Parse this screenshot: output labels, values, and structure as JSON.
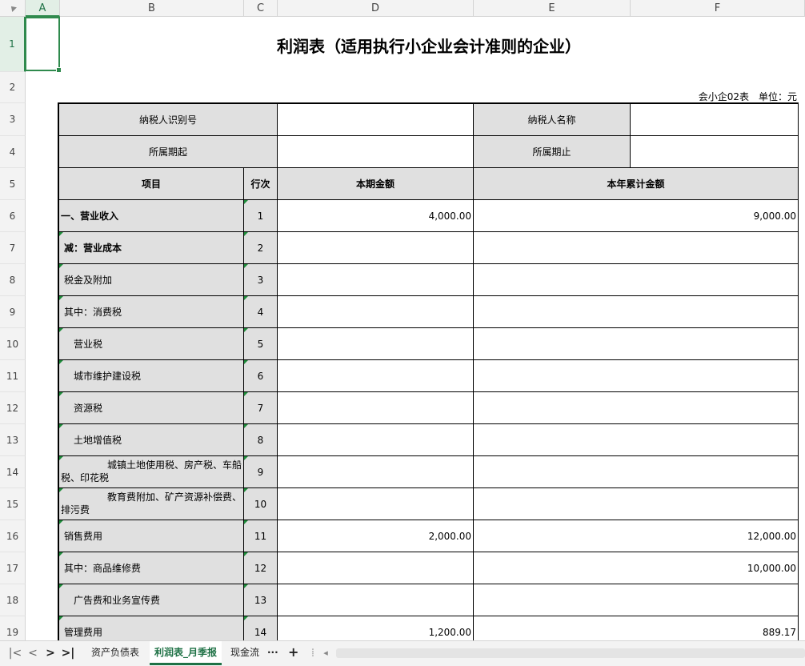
{
  "columns": [
    "A",
    "B",
    "C",
    "D",
    "E",
    "F"
  ],
  "rows": [
    "1",
    "2",
    "3",
    "4",
    "5",
    "6",
    "7",
    "8",
    "9",
    "10",
    "11",
    "12",
    "13",
    "14",
    "15",
    "16",
    "17",
    "18",
    "19"
  ],
  "sheet": {
    "title": "利润表（适用执行小企业会计准则的企业）",
    "unit_note": "会小企02表　单位：元",
    "taxpayer_id_label": "纳税人识别号",
    "taxpayer_id_value": "",
    "taxpayer_name_label": "纳税人名称",
    "taxpayer_name_value": "",
    "period_start_label": "所属期起",
    "period_start_value": "",
    "period_end_label": "所属期止",
    "period_end_value": "",
    "header_item": "项目",
    "header_line": "行次",
    "header_current": "本期金额",
    "header_ytd": "本年累计金额",
    "items": [
      {
        "label": "一、营业收入",
        "line": "1",
        "current": "4,000.00",
        "ytd": "9,000.00",
        "bold": true,
        "indent": 0
      },
      {
        "label": "减：营业成本",
        "line": "2",
        "current": "",
        "ytd": "",
        "bold": true,
        "indent": 1
      },
      {
        "label": "税金及附加",
        "line": "3",
        "current": "",
        "ytd": "",
        "bold": false,
        "indent": 1
      },
      {
        "label": "其中：消费税",
        "line": "4",
        "current": "",
        "ytd": "",
        "bold": false,
        "indent": 2
      },
      {
        "label": "营业税",
        "line": "5",
        "current": "",
        "ytd": "",
        "bold": false,
        "indent": 3
      },
      {
        "label": "城市维护建设税",
        "line": "6",
        "current": "",
        "ytd": "",
        "bold": false,
        "indent": 3
      },
      {
        "label": "资源税",
        "line": "7",
        "current": "",
        "ytd": "",
        "bold": false,
        "indent": 3
      },
      {
        "label": "土地增值税",
        "line": "8",
        "current": "",
        "ytd": "",
        "bold": false,
        "indent": 3
      },
      {
        "label": "城镇土地使用税、房产税、车船税、印花税",
        "line": "9",
        "current": "",
        "ytd": "",
        "bold": false,
        "indent": 4
      },
      {
        "label": "教育费附加、矿产资源补偿费、排污费",
        "line": "10",
        "current": "",
        "ytd": "",
        "bold": false,
        "indent": 4
      },
      {
        "label": "销售费用",
        "line": "11",
        "current": "2,000.00",
        "ytd": "12,000.00",
        "bold": false,
        "indent": 1
      },
      {
        "label": "其中：商品维修费",
        "line": "12",
        "current": "",
        "ytd": "10,000.00",
        "bold": false,
        "indent": 2
      },
      {
        "label": "广告费和业务宣传费",
        "line": "13",
        "current": "",
        "ytd": "",
        "bold": false,
        "indent": 3
      },
      {
        "label": "管理费用",
        "line": "14",
        "current": "1,200.00",
        "ytd": "889.17",
        "bold": false,
        "indent": 1
      }
    ]
  },
  "tabs": {
    "sheet1": "资产负债表",
    "sheet2": "利润表_月季报",
    "sheet3": "现金流",
    "more": "···",
    "add": "+"
  },
  "nav": {
    "first": "|<",
    "prev": "<",
    "next": ">",
    "last": ">|"
  },
  "colors": {
    "accent": "#1e7145",
    "header_fill": "#e0e0e0",
    "selection": "#2f8a4d"
  }
}
